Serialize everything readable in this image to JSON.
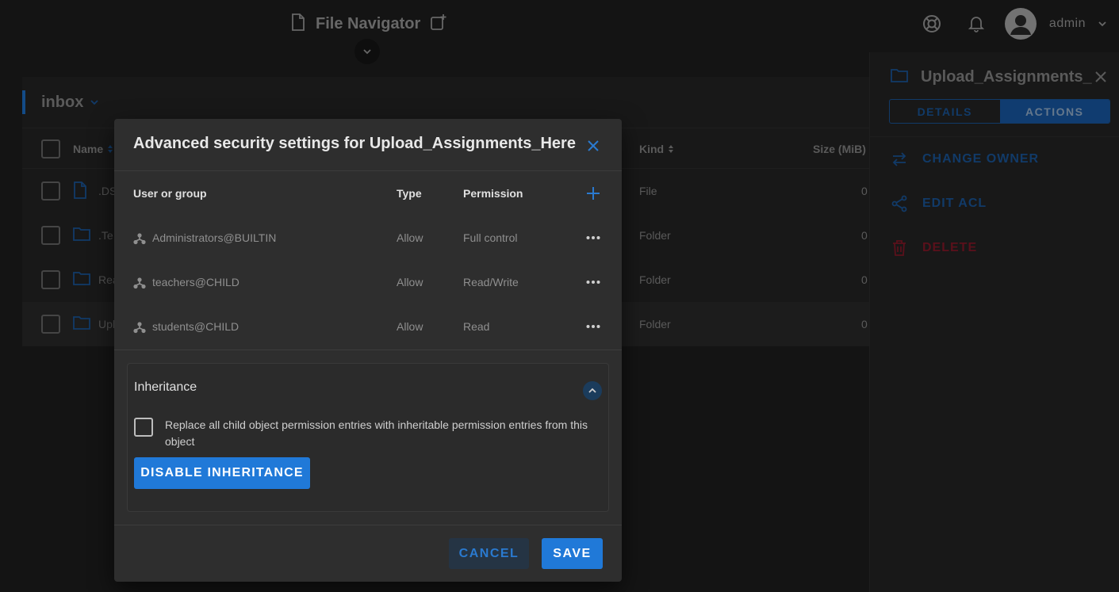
{
  "app": {
    "title": "File Navigator",
    "username": "admin"
  },
  "breadcrumb": {
    "current": "inbox"
  },
  "file_table": {
    "columns": {
      "name": "Name",
      "kind": "Kind",
      "size": "Size (MiB)"
    },
    "rows": [
      {
        "name": ".DS",
        "kind": "File",
        "size": "0",
        "icon": "file-icon"
      },
      {
        "name": ".Te",
        "kind": "Folder",
        "size": "0",
        "icon": "folder-icon"
      },
      {
        "name": "Rea",
        "kind": "Folder",
        "size": "0",
        "icon": "folder-icon"
      },
      {
        "name": "Upl",
        "kind": "Folder",
        "size": "0",
        "icon": "folder-icon"
      }
    ]
  },
  "side_panel": {
    "title": "Upload_Assignments_H",
    "tabs": [
      "DETAILS",
      "ACTIONS"
    ],
    "active_tab": "ACTIONS",
    "actions": [
      "CHANGE OWNER",
      "EDIT ACL",
      "DELETE"
    ]
  },
  "dialog": {
    "title": "Advanced security settings for Upload_Assignments_Here",
    "columns": {
      "user": "User or group",
      "type": "Type",
      "permission": "Permission"
    },
    "entries": [
      {
        "user": "Administrators@BUILTIN",
        "type": "Allow",
        "permission": "Full control"
      },
      {
        "user": "teachers@CHILD",
        "type": "Allow",
        "permission": "Read/Write"
      },
      {
        "user": "students@CHILD",
        "type": "Allow",
        "permission": "Read"
      }
    ],
    "inheritance": {
      "title": "Inheritance",
      "replace_label": "Replace all child object permission entries with inheritable permission entries from this object",
      "disable_button": "DISABLE INHERITANCE"
    },
    "cancel": "CANCEL",
    "save": "SAVE"
  },
  "colors": {
    "accent": "#2079d8",
    "danger": "#8a1a2a",
    "background": "#1f1f1f",
    "dialog": "#2e2e2e"
  }
}
